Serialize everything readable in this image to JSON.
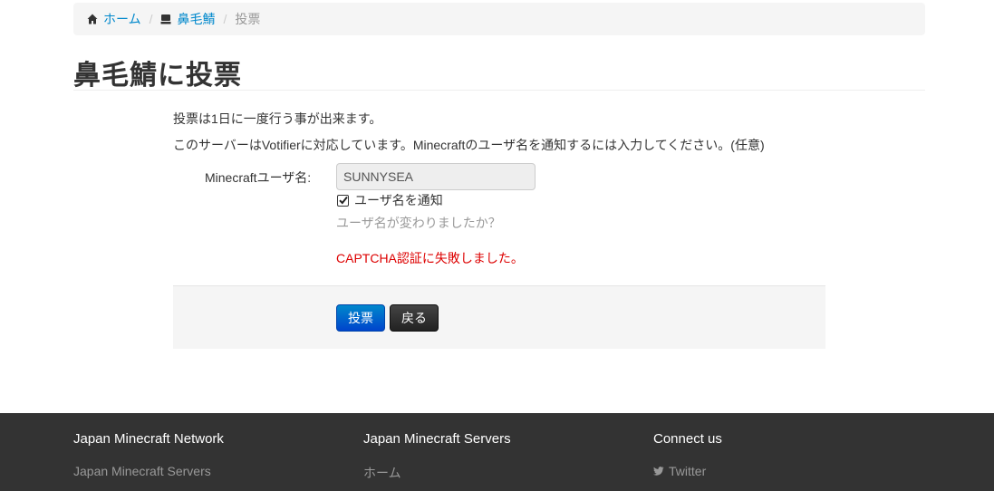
{
  "breadcrumb": {
    "home": "ホーム",
    "server": "鼻毛鯖",
    "current": "投票"
  },
  "page": {
    "title": "鼻毛鯖に投票"
  },
  "info": {
    "line1": "投票は1日に一度行う事が出来ます。",
    "line2": "このサーバーはVotifierに対応しています。Minecraftのユーザ名を通知するには入力してください。(任意)"
  },
  "form": {
    "username_label": "Minecraftユーザ名:",
    "username_value": "SUNNYSEA",
    "notify_label": "ユーザ名を通知",
    "notify_checked": true,
    "help_text": "ユーザ名が変わりましたか？",
    "error_text": "CAPTCHA認証に失敗しました。"
  },
  "actions": {
    "vote": "投票",
    "back": "戻る"
  },
  "footer": {
    "col1": {
      "heading": "Japan Minecraft Network",
      "link": "Japan Minecraft Servers"
    },
    "col2": {
      "heading": "Japan Minecraft Servers",
      "link": "ホーム"
    },
    "col3": {
      "heading": "Connect us",
      "link": "Twitter"
    }
  },
  "colors": {
    "link": "#0088cc",
    "error": "#dd0000",
    "vote_button": "#0055cc",
    "back_button": "#333333",
    "footer_bg": "#333333"
  },
  "icons": {
    "home": "home-icon",
    "server": "server-icon",
    "check": "check-icon",
    "twitter": "twitter-icon"
  }
}
